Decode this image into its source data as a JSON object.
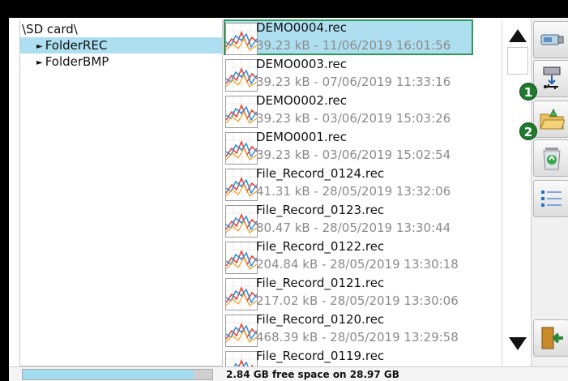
{
  "tree": {
    "root": "\\SD card\\",
    "items": [
      {
        "label": "FolderREC",
        "selected": true
      },
      {
        "label": "FolderBMP",
        "selected": false
      }
    ]
  },
  "files": [
    {
      "name": "DEMO0004.rec",
      "info": "39.23 kB - 11/06/2019 16:01:56",
      "selected": true
    },
    {
      "name": "DEMO0003.rec",
      "info": "39.23 kB - 07/06/2019 11:33:16"
    },
    {
      "name": "DEMO0002.rec",
      "info": "39.23 kB - 03/06/2019 15:03:26"
    },
    {
      "name": "DEMO0001.rec",
      "info": "39.23 kB - 03/06/2019 15:02:54"
    },
    {
      "name": "File_Record_0124.rec",
      "info": "41.31 kB - 28/05/2019 13:32:06"
    },
    {
      "name": "File_Record_0123.rec",
      "info": "80.47 kB - 28/05/2019 13:30:44"
    },
    {
      "name": "File_Record_0122.rec",
      "info": "204.84 kB - 28/05/2019 13:30:18"
    },
    {
      "name": "File_Record_0121.rec",
      "info": "217.02 kB - 28/05/2019 13:30:06"
    },
    {
      "name": "File_Record_0120.rec",
      "info": "468.39 kB - 28/05/2019 13:29:58"
    },
    {
      "name": "File_Record_0119.rec",
      "info": ""
    }
  ],
  "toolbar": {
    "buttons": [
      "usb-drive-icon",
      "usb-transfer-icon",
      "open-folder-icon",
      "recycle-bin-icon",
      "list-view-icon",
      "exit-door-icon"
    ],
    "badge_1": "1",
    "badge_2": "2"
  },
  "status": {
    "text": "2.84 GB free space on 28.97 GB",
    "used_fraction": 0.902
  },
  "colors": {
    "selection": "#aedff0",
    "selection_border": "#2e9a5a",
    "badge": "#1f7a30"
  }
}
